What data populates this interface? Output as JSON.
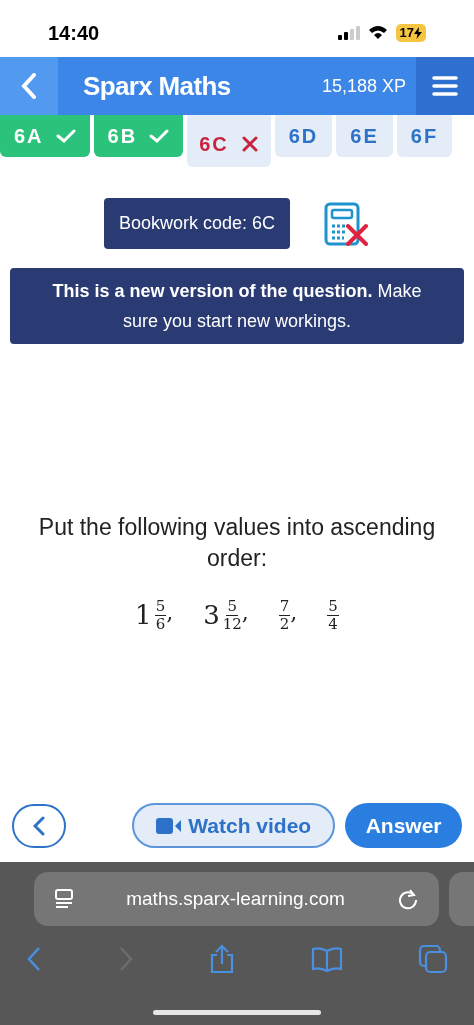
{
  "status_bar": {
    "time": "14:40",
    "battery": "17"
  },
  "header": {
    "title": "Sparx Maths",
    "xp": "15,188 XP"
  },
  "tabs": [
    {
      "label": "6A",
      "kind": "correct",
      "selected": false
    },
    {
      "label": "6B",
      "kind": "correct",
      "selected": false
    },
    {
      "label": "6C",
      "kind": "wrong",
      "selected": true
    },
    {
      "label": "6D",
      "kind": "plain",
      "selected": false
    },
    {
      "label": "6E",
      "kind": "plain",
      "selected": false
    },
    {
      "label": "6F",
      "kind": "plain",
      "selected": false
    }
  ],
  "bookwork_code": "Bookwork code: 6C",
  "notice": "**This is a new version of the question.** Make sure you start new workings.",
  "question": "Put the following values into ascending order:",
  "values": [
    {
      "whole": "1",
      "numerator": "5",
      "denominator": "6",
      "separator": ","
    },
    {
      "whole": "3",
      "numerator": "5",
      "denominator": "12",
      "separator": ","
    },
    {
      "numerator": "7",
      "denominator": "2",
      "separator": ","
    },
    {
      "numerator": "5",
      "denominator": "4"
    }
  ],
  "buttons": {
    "watch_video": "Watch video",
    "answer": "Answer"
  },
  "browser": {
    "url": "maths.sparx-learning.com"
  }
}
